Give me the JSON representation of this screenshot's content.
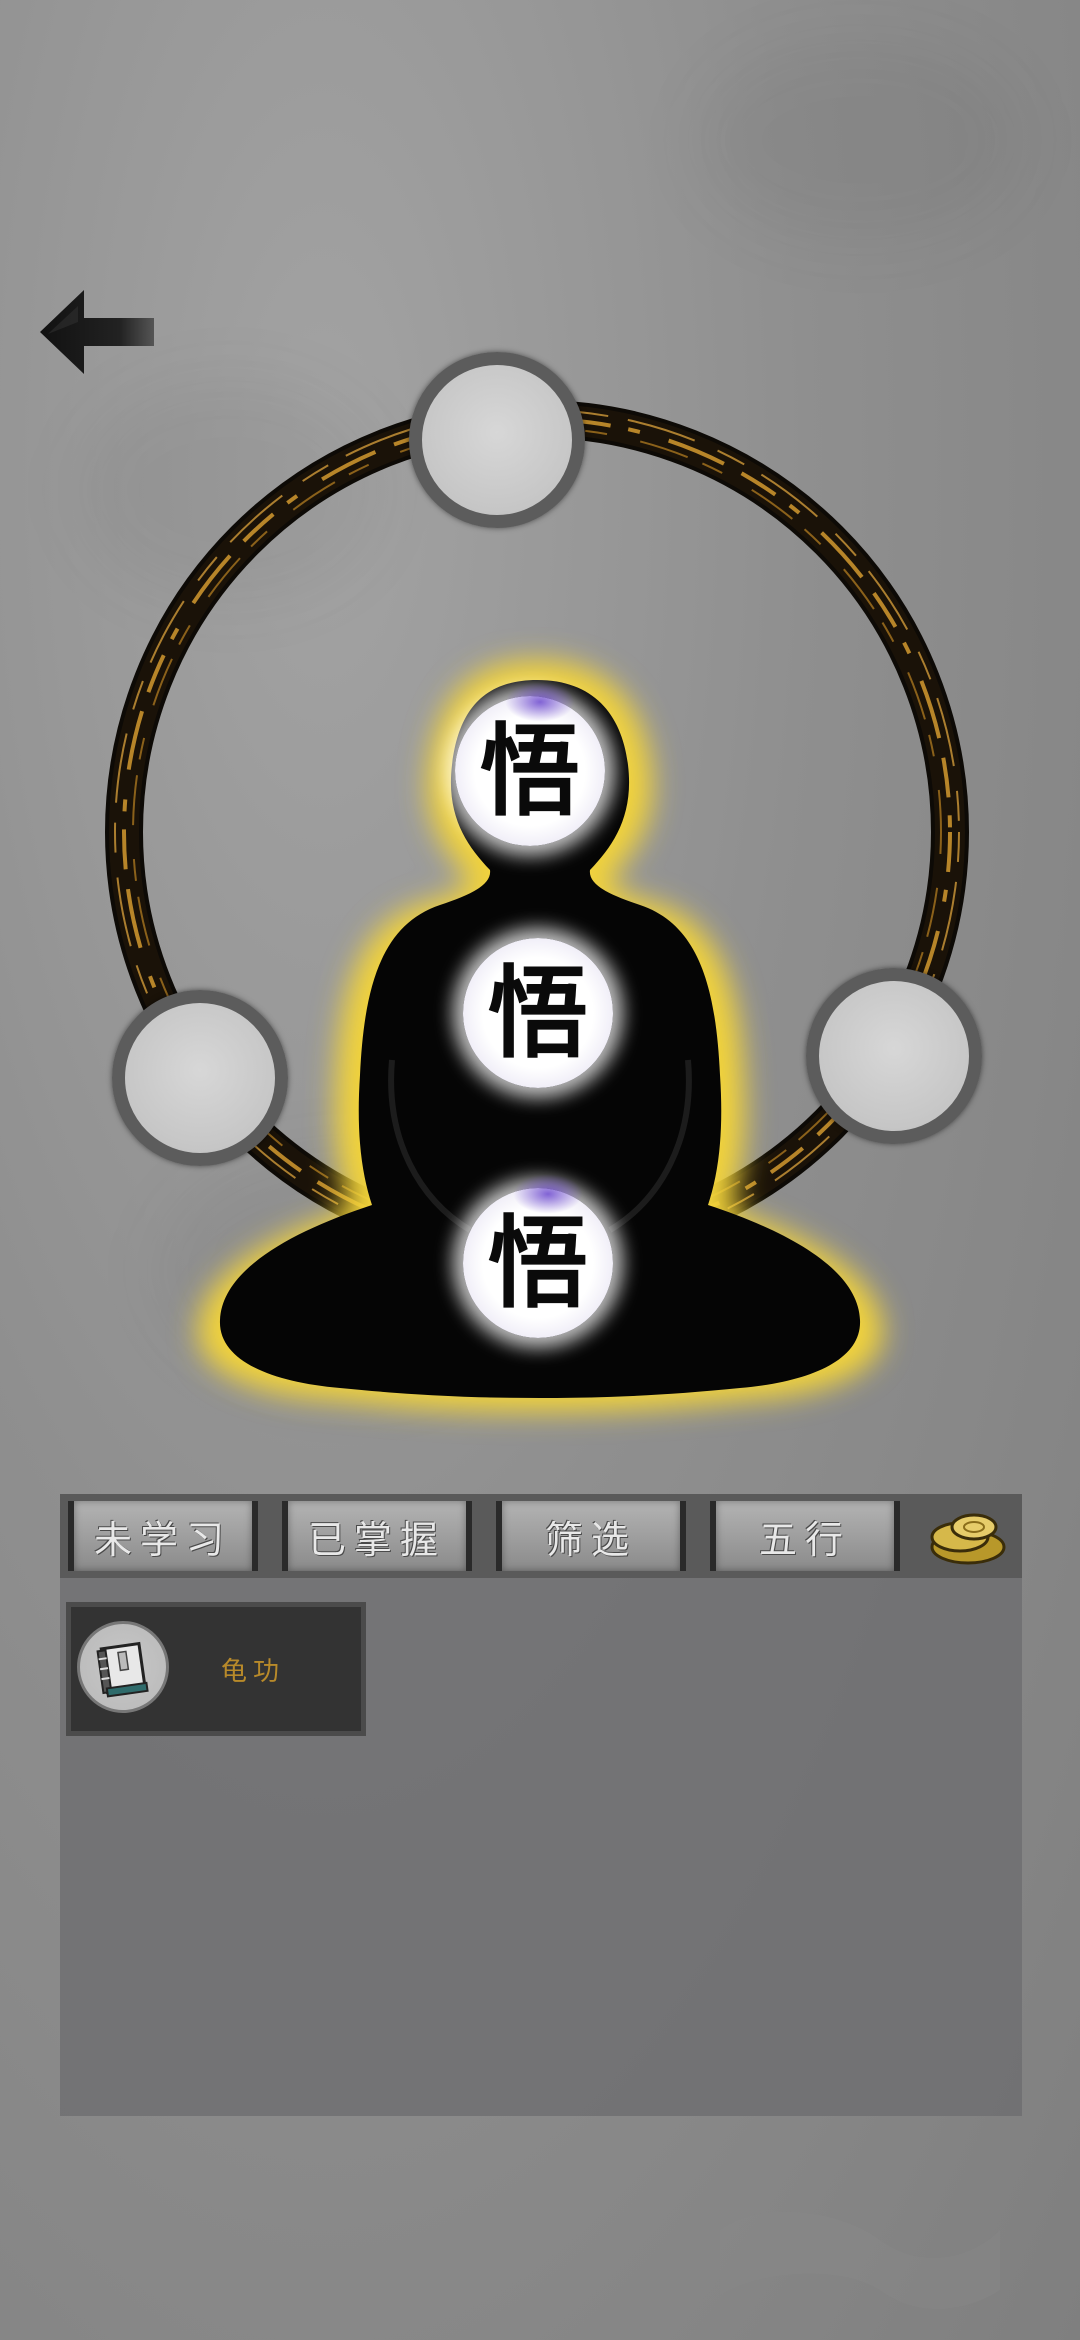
{
  "header": {
    "back_icon": "back-arrow-icon"
  },
  "meridian": {
    "ring_color": "#c9922e",
    "aura_color": "#f2d33a",
    "slots": [
      {
        "name": "slot-top",
        "state": "empty"
      },
      {
        "name": "slot-left",
        "state": "empty"
      },
      {
        "name": "slot-right",
        "state": "empty"
      }
    ],
    "orbs": [
      {
        "char": "悟"
      },
      {
        "char": "悟"
      },
      {
        "char": "悟"
      }
    ]
  },
  "tabs": [
    {
      "label": "未学习"
    },
    {
      "label": "已掌握"
    },
    {
      "label": "筛选"
    },
    {
      "label": "五行"
    }
  ],
  "tab_extra_icon": "gold-coins-icon",
  "skills": [
    {
      "name": "龟功",
      "icon": "book-icon"
    }
  ]
}
